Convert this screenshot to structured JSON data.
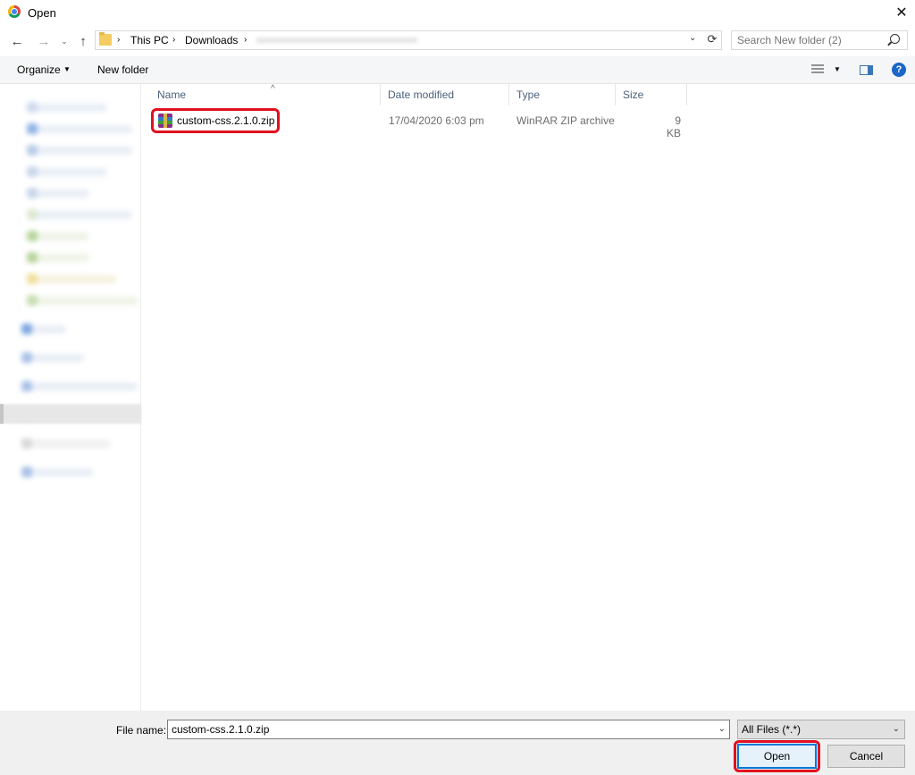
{
  "window": {
    "title": "Open",
    "close_glyph": "✕"
  },
  "nav": {
    "back_glyph": "←",
    "forward_glyph": "→",
    "recent_glyph": "⌄",
    "up_glyph": "↑",
    "breadcrumbs": [
      {
        "label": "This PC"
      },
      {
        "label": "Downloads"
      }
    ],
    "crumb_separator": "›",
    "dropdown_glyph": "⌄",
    "refresh_glyph": "⟳"
  },
  "search": {
    "placeholder": "Search New folder (2)"
  },
  "toolbar": {
    "organize_label": "Organize",
    "organize_arrow": "▼",
    "new_folder_label": "New folder",
    "views_arrow": "▼",
    "help_glyph": "?"
  },
  "columns": {
    "name": "Name",
    "date": "Date modified",
    "type": "Type",
    "size": "Size",
    "sort_glyph": "^"
  },
  "files": [
    {
      "name": "custom-css.2.1.0.zip",
      "date": "17/04/2020 6:03 pm",
      "type": "WinRAR ZIP archive",
      "size": "9 KB",
      "icon": "winrar-archive-icon"
    }
  ],
  "bottom": {
    "file_name_label": "File name:",
    "file_name_value": "custom-css.2.1.0.zip",
    "dropdown_glyph": "⌄",
    "file_type_value": "All Files (*.*)",
    "open_label": "Open",
    "cancel_label": "Cancel"
  },
  "colors": {
    "accent": "#0078d7",
    "highlight": "#e01020",
    "help": "#1a66c9"
  }
}
